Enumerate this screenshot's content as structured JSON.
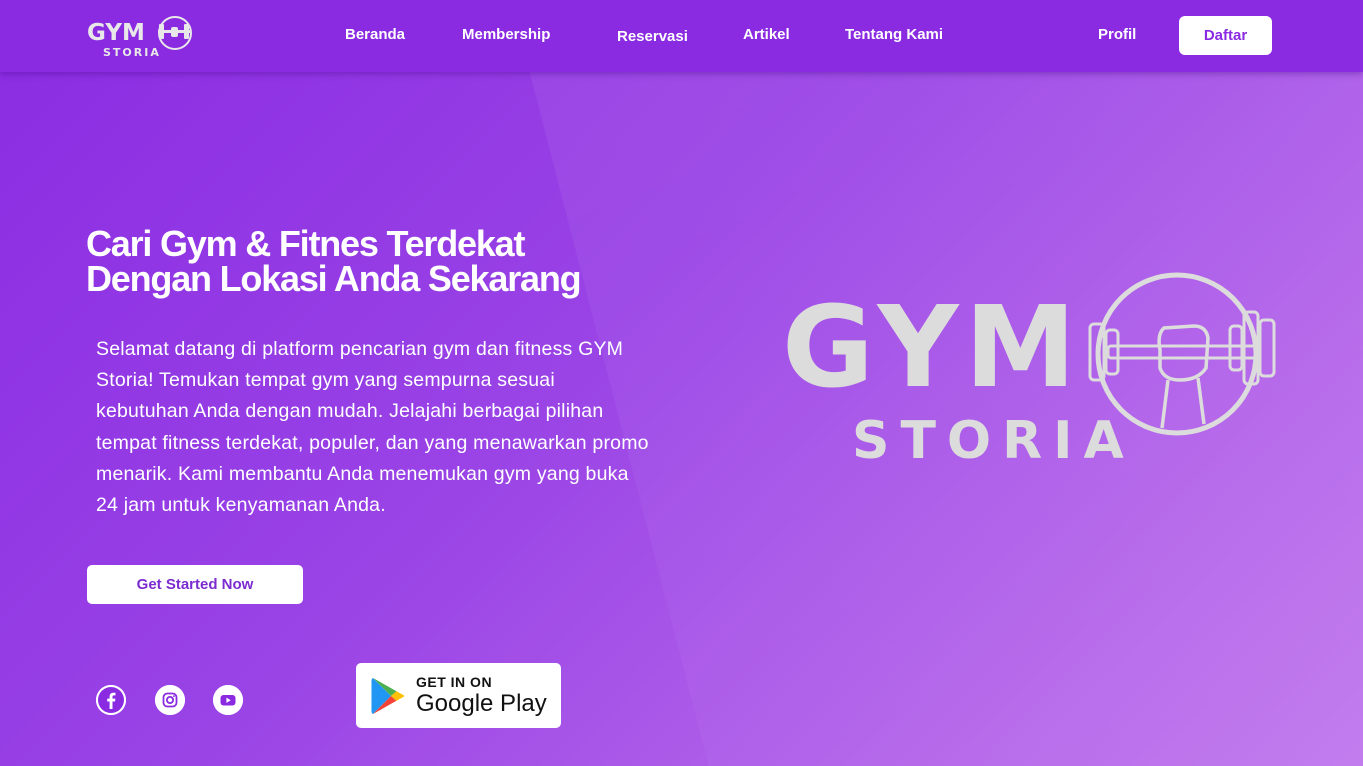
{
  "brand": {
    "logo_line1": "GYM",
    "logo_line2": "STORIA",
    "colors": {
      "primary": "#8a2be2",
      "accent_text": "#7b2bd0",
      "logo_gray": "#dcdcdc"
    }
  },
  "nav": {
    "items": [
      {
        "label": "Beranda"
      },
      {
        "label": "Membership"
      },
      {
        "label": "Reservasi"
      },
      {
        "label": "Artikel"
      },
      {
        "label": "Tentang Kami"
      }
    ],
    "profile_label": "Profil",
    "signup_label": "Daftar"
  },
  "hero": {
    "title_line1": "Cari Gym & Fitnes Terdekat",
    "title_line2": "Dengan Lokasi Anda Sekarang",
    "description_lines": [
      "Selamat datang di platform pencarian gym dan fitness GYM",
      "Storia! Temukan tempat gym yang sempurna sesuai",
      "kebutuhan Anda dengan mudah. Jelajahi berbagai pilihan",
      "tempat fitness terdekat, populer, dan yang menawarkan promo",
      "menarik. Kami membantu Anda menemukan gym yang buka",
      "24 jam untuk kenyamanan Anda."
    ],
    "cta_label": "Get Started Now"
  },
  "social": {
    "icons": [
      "facebook-icon",
      "instagram-icon",
      "youtube-icon"
    ]
  },
  "google_play": {
    "top_text": "GET IN ON",
    "main_text": "Google Play",
    "icon": "google-play-icon"
  },
  "hero_logo": {
    "line1": "GYM",
    "line2": "STORIA",
    "icon": "dumbbell-fist-icon"
  }
}
